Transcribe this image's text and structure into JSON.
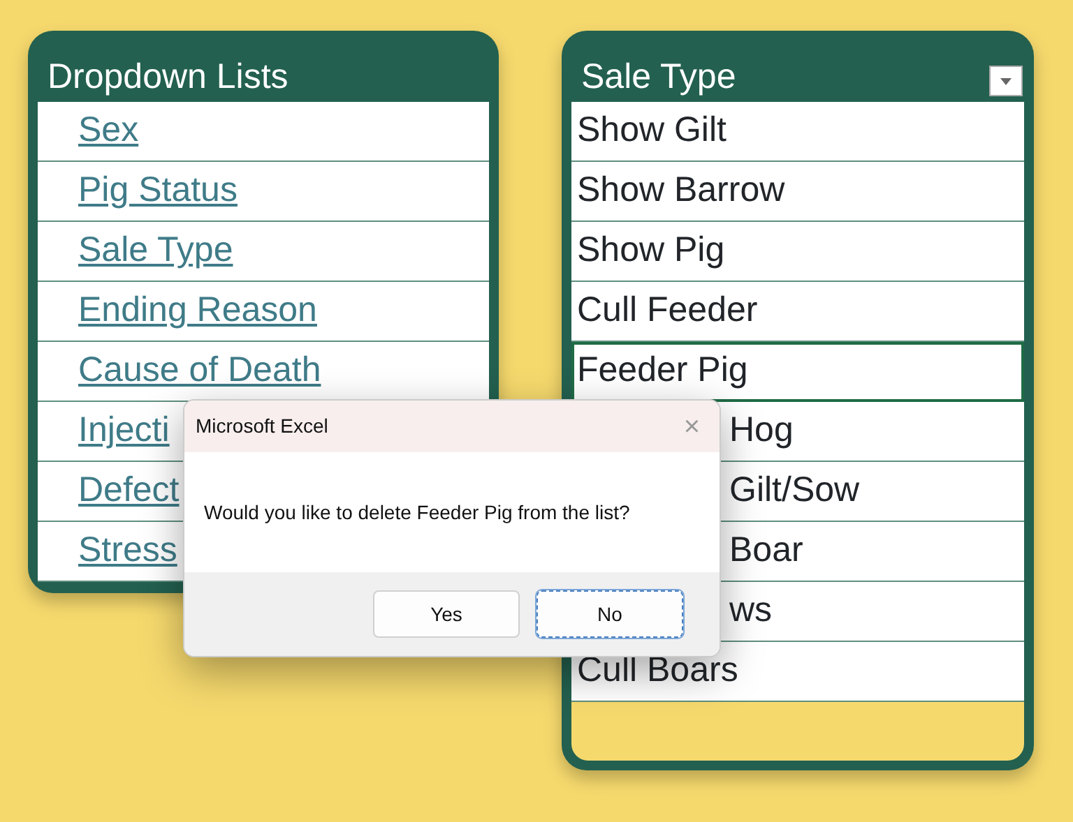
{
  "left_table": {
    "header": "Dropdown Lists",
    "rows": [
      {
        "text": "Sex"
      },
      {
        "text": "Pig Status"
      },
      {
        "text": "Sale Type"
      },
      {
        "text": "Ending Reason"
      },
      {
        "text": "Cause of Death"
      },
      {
        "text": "Injecti"
      },
      {
        "text": "Defect"
      },
      {
        "text": "Stress"
      }
    ]
  },
  "right_table": {
    "header": "Sale Type",
    "rows": [
      {
        "text": "Show Gilt",
        "selected": false
      },
      {
        "text": "Show Barrow",
        "selected": false
      },
      {
        "text": "Show Pig",
        "selected": false
      },
      {
        "text": "Cull Feeder",
        "selected": false
      },
      {
        "text": "Feeder Pig",
        "selected": true
      },
      {
        "text": "Hog",
        "selected": false
      },
      {
        "text": "Gilt/Sow",
        "selected": false
      },
      {
        "text": "Boar",
        "selected": false
      },
      {
        "text": "ws",
        "selected": false
      },
      {
        "text": "Cull Boars",
        "selected": false
      }
    ]
  },
  "dialog": {
    "title": "Microsoft Excel",
    "close": "×",
    "message": "Would you like to delete Feeder Pig from the list?",
    "buttons": [
      {
        "label": "Yes",
        "focused": false
      },
      {
        "label": "No",
        "focused": true
      }
    ]
  }
}
